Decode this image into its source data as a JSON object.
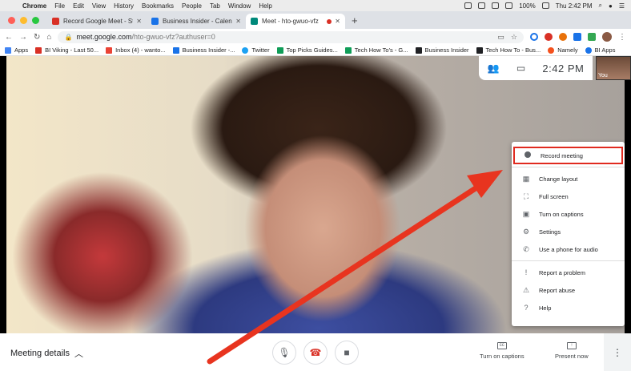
{
  "menubar": {
    "apple_glyph": "",
    "app_name": "Chrome",
    "items": [
      "File",
      "Edit",
      "View",
      "History",
      "Bookmarks",
      "People",
      "Tab",
      "Window",
      "Help"
    ],
    "battery": "100%",
    "clock": "Thu 2:42 PM"
  },
  "tabs": [
    {
      "title": "Record Google Meet - Steven",
      "favicon_color": "#d93025"
    },
    {
      "title": "Business Insider - Calendar - V",
      "favicon_color": "#1a73e8"
    },
    {
      "title": "Meet - hto-gwuo-vfz",
      "favicon_color": "#00897b"
    }
  ],
  "newtab_label": "+",
  "address": {
    "host": "meet.google.com",
    "path": "/hto-gwuo-vfz?authuser=0"
  },
  "bookmarks": [
    {
      "label": "Apps",
      "color": "#4285f4"
    },
    {
      "label": "BI Viking - Last 50...",
      "color": "#d93025"
    },
    {
      "label": "Inbox (4) - wanto...",
      "color": "#ea4335"
    },
    {
      "label": "Business Insider -...",
      "color": "#1a73e8"
    },
    {
      "label": "Twitter",
      "color": "#1da1f2"
    },
    {
      "label": "Top Picks Guides...",
      "color": "#0f9d58"
    },
    {
      "label": "Tech How To's - G...",
      "color": "#0f9d58"
    },
    {
      "label": "Business Insider",
      "color": "#202124"
    },
    {
      "label": "Tech How To - Bus...",
      "color": "#202124"
    },
    {
      "label": "Namely",
      "color": "#f4511e"
    },
    {
      "label": "BI Apps",
      "color": "#1a73e8"
    }
  ],
  "meet": {
    "time": "2:42 PM",
    "self_label": "You",
    "menu": [
      {
        "label": "Record meeting",
        "icon": "record-dot-icon"
      },
      {
        "label": "Change layout",
        "icon": "layout-icon"
      },
      {
        "label": "Full screen",
        "icon": "fullscreen-icon"
      },
      {
        "label": "Turn on captions",
        "icon": "captions-icon"
      },
      {
        "label": "Settings",
        "icon": "gear-icon"
      },
      {
        "label": "Use a phone for audio",
        "icon": "phone-icon"
      },
      {
        "label": "Report a problem",
        "icon": "report-problem-icon"
      },
      {
        "label": "Report abuse",
        "icon": "report-abuse-icon"
      },
      {
        "label": "Help",
        "icon": "help-icon"
      }
    ],
    "bottom": {
      "details_label": "Meeting details",
      "captions_label": "Turn on captions",
      "present_label": "Present now"
    },
    "highlight_color": "#e02a1f"
  }
}
